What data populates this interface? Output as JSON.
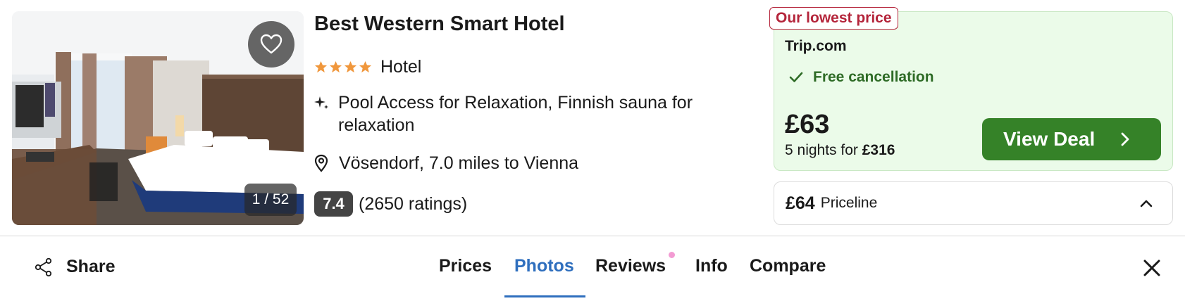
{
  "hotel": {
    "name": "Best Western Smart Hotel",
    "star_count": 4,
    "type": "Hotel",
    "amenities": "Pool Access for Relaxation, Finnish sauna for relaxation",
    "location": "Vösendorf, 7.0 miles to Vienna",
    "rating_score": "7.4",
    "rating_count": "(2650 ratings)"
  },
  "photo": {
    "counter": "1 / 52",
    "favorite_icon": "heart-outline-icon"
  },
  "deal": {
    "badge": "Our lowest price",
    "provider": "Trip.com",
    "free_cancellation": "Free cancellation",
    "price": "£63",
    "nights_prefix": "5 nights for ",
    "nights_total": "£316",
    "button_label": "View Deal"
  },
  "alt_deal": {
    "price": "£64",
    "provider": "Priceline"
  },
  "tabs_bar": {
    "share_label": "Share",
    "tabs": [
      "Prices",
      "Photos",
      "Reviews",
      "Info",
      "Compare"
    ],
    "active_tab": "Photos"
  },
  "colors": {
    "accent_blue": "#2f6fbe",
    "deal_green": "#358228",
    "badge_red": "#b4243a",
    "star_orange": "#f0973c",
    "deal_bg": "#ebfbe9"
  }
}
